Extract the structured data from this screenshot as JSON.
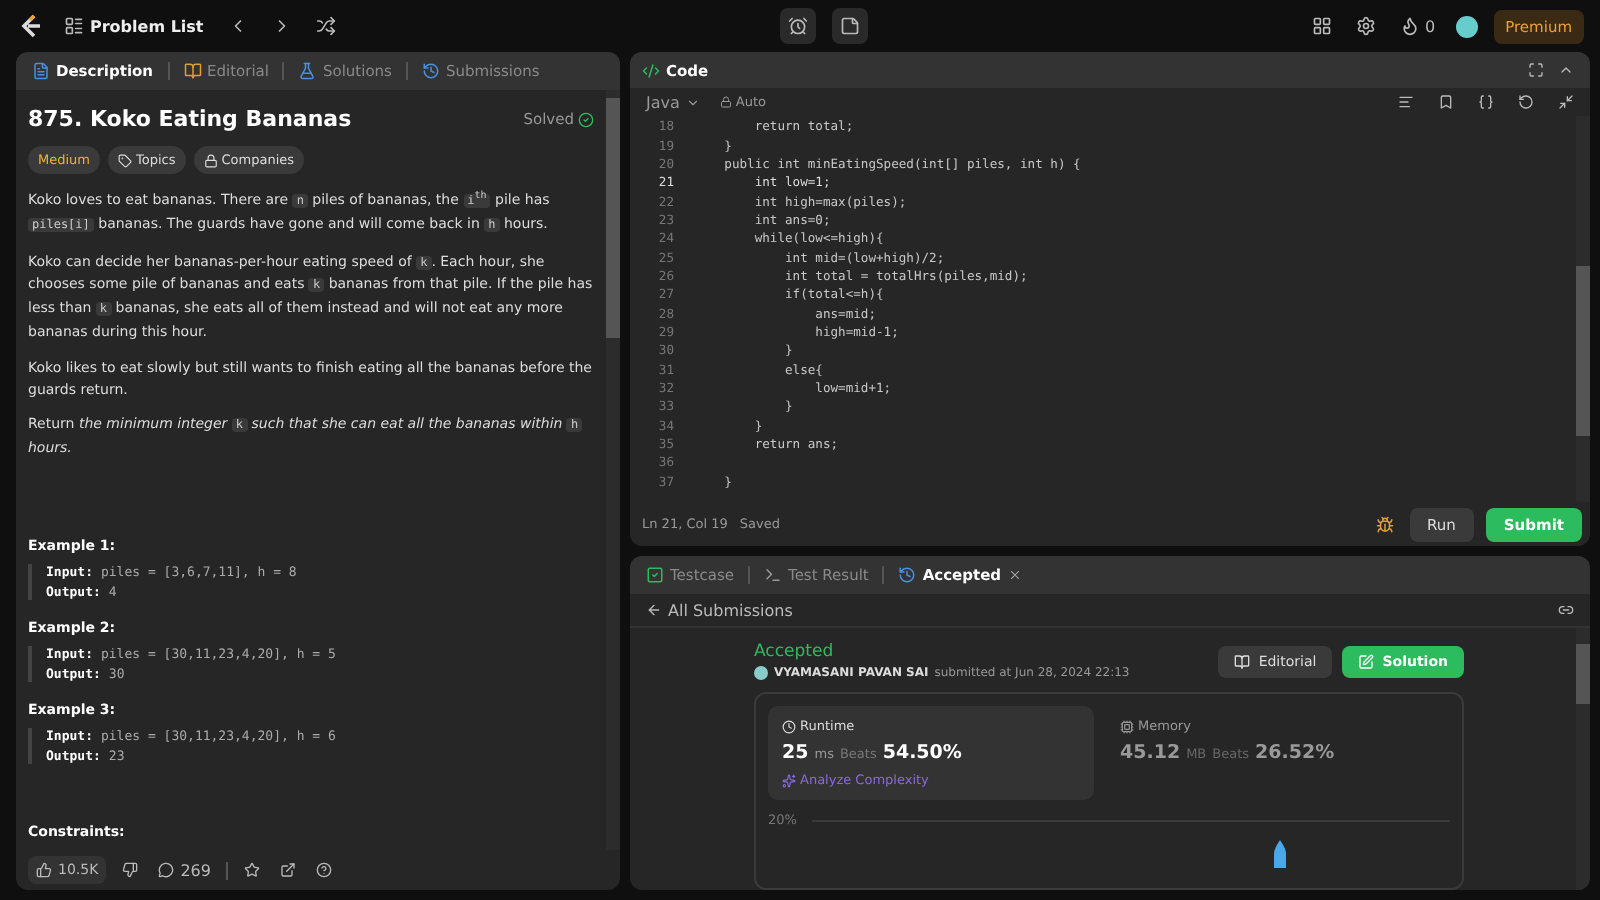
{
  "topbar": {
    "title": "Problem List",
    "streak": "0",
    "premium": "Premium"
  },
  "left_tabs": [
    {
      "label": "Description",
      "selected": true
    },
    {
      "label": "Editorial",
      "selected": false
    },
    {
      "label": "Solutions",
      "selected": false
    },
    {
      "label": "Submissions",
      "selected": false
    }
  ],
  "problem": {
    "title": "875. Koko Eating Bananas",
    "status": "Solved",
    "difficulty": "Medium",
    "tags": [
      "Topics",
      "Companies"
    ],
    "paragraphs": [
      [
        {
          "kind": "text",
          "text": "Koko loves to eat bananas. There are "
        },
        {
          "kind": "code",
          "text": "n"
        },
        {
          "kind": "text",
          "text": " piles of bananas, the "
        },
        {
          "kind": "code",
          "text": "i$^{th}$"
        },
        {
          "kind": "text",
          "text": " pile has "
        },
        {
          "kind": "code",
          "text": "piles[i]"
        },
        {
          "kind": "text",
          "text": " bananas. The guards have gone and will come back in "
        },
        {
          "kind": "code",
          "text": "h"
        },
        {
          "kind": "text",
          "text": " hours."
        }
      ],
      [
        {
          "kind": "text",
          "text": "Koko can decide her bananas-per-hour eating speed of "
        },
        {
          "kind": "code",
          "text": "k"
        },
        {
          "kind": "text",
          "text": ". Each hour, she chooses some pile of bananas and eats "
        },
        {
          "kind": "code",
          "text": "k"
        },
        {
          "kind": "text",
          "text": " bananas from that pile. If the pile has less than "
        },
        {
          "kind": "code",
          "text": "k"
        },
        {
          "kind": "text",
          "text": " bananas, she eats all of them instead and will not eat any more bananas during this hour."
        }
      ],
      [
        {
          "kind": "text",
          "text": "Koko likes to eat slowly but still wants to finish eating all the bananas before the guards return."
        }
      ],
      [
        {
          "kind": "text",
          "text": "Return *the minimum integer* "
        },
        {
          "kind": "code",
          "text": "k"
        },
        {
          "kind": "text",
          "text": " *such that she can eat all the bananas within* "
        },
        {
          "kind": "code",
          "text": "h"
        },
        {
          "kind": "text",
          "text": " *hours.*"
        }
      ]
    ],
    "examples": [
      {
        "title": "Example 1:",
        "input_label": "Input:",
        "input": "piles = [3,6,7,11], h = 8",
        "output_label": "Output:",
        "output": "4"
      },
      {
        "title": "Example 2:",
        "input_label": "Input:",
        "input": "piles = [30,11,23,4,20], h = 5",
        "output_label": "Output:",
        "output": "30"
      },
      {
        "title": "Example 3:",
        "input_label": "Input:",
        "input": "piles = [30,11,23,4,20], h = 6",
        "output_label": "Output:",
        "output": "23"
      }
    ],
    "constraints_title": "Constraints:"
  },
  "left_footer": {
    "likes": "10.5K",
    "comments": "269"
  },
  "code": {
    "title": "Code",
    "language": "Java",
    "mode": "Auto",
    "status": "Ln 21, Col 19",
    "saved": "Saved",
    "run": "Run",
    "submit": "Submit",
    "lines": [
      {
        "number": "18",
        "text": "        return total;",
        "current": false
      },
      {
        "number": "19",
        "text": "    }",
        "current": false
      },
      {
        "number": "20",
        "text": "    public int minEatingSpeed(int[] piles, int h) {",
        "current": false
      },
      {
        "number": "21",
        "text": "        int low=1;",
        "current": true
      },
      {
        "number": "22",
        "text": "        int high=max(piles);",
        "current": false
      },
      {
        "number": "23",
        "text": "        int ans=0;",
        "current": false
      },
      {
        "number": "24",
        "text": "        while(low<=high){",
        "current": false
      },
      {
        "number": "25",
        "text": "            int mid=(low+high)/2;",
        "current": false
      },
      {
        "number": "26",
        "text": "            int total = totalHrs(piles,mid);",
        "current": false
      },
      {
        "number": "27",
        "text": "            if(total<=h){",
        "current": false
      },
      {
        "number": "28",
        "text": "                ans=mid;",
        "current": false
      },
      {
        "number": "29",
        "text": "                high=mid-1;",
        "current": false
      },
      {
        "number": "30",
        "text": "            }",
        "current": false
      },
      {
        "number": "31",
        "text": "            else{",
        "current": false
      },
      {
        "number": "32",
        "text": "                low=mid+1;",
        "current": false
      },
      {
        "number": "33",
        "text": "            }",
        "current": false
      },
      {
        "number": "34",
        "text": "        }",
        "current": false
      },
      {
        "number": "35",
        "text": "        return ans;",
        "current": false
      },
      {
        "number": "36",
        "current": false
      },
      {
        "number": "37",
        "text": "    }",
        "current": false
      }
    ]
  },
  "bottom_tabs": [
    {
      "label": "Testcase",
      "selected": false
    },
    {
      "label": "Test Result",
      "selected": false
    },
    {
      "label": "Accepted",
      "selected": true
    }
  ],
  "submission": {
    "back": "All Submissions",
    "verdict": "Accepted",
    "user": "VYAMASANI PAVAN SAI",
    "submitted": "submitted at Jun 28, 2024 22:13",
    "editorial": "Editorial",
    "solution": "Solution",
    "runtime": {
      "label": "Runtime",
      "value": "25",
      "unit": "ms",
      "beats_label": "Beats",
      "beats": "54.50%",
      "analyze": "Analyze Complexity"
    },
    "memory": {
      "label": "Memory",
      "value": "45.12",
      "unit": "MB",
      "beats_label": "Beats",
      "beats": "26.52%"
    },
    "chart_tick": "20%"
  }
}
